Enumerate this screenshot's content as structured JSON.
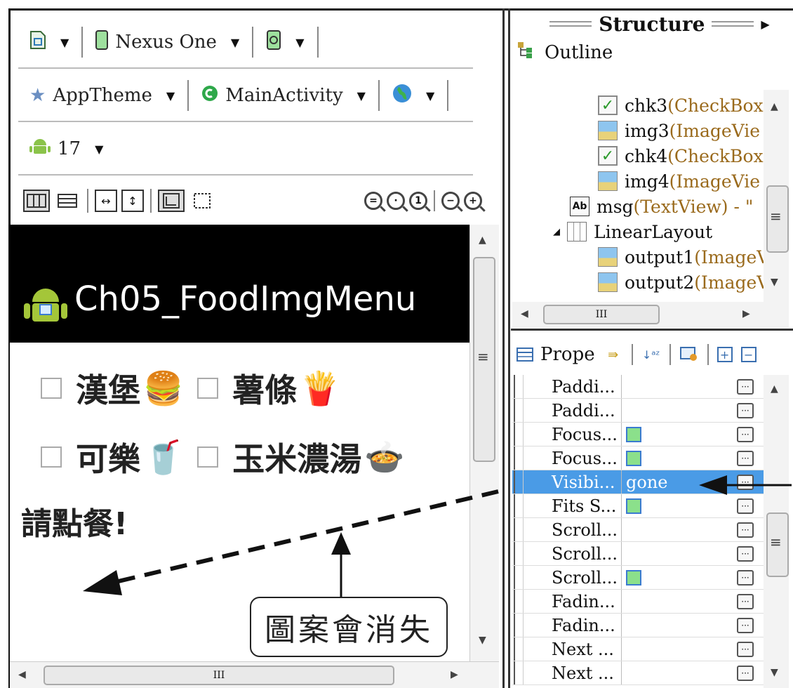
{
  "toolbar": {
    "device": "Nexus One",
    "theme": "AppTheme",
    "activity": "MainActivity",
    "api_level": "17"
  },
  "preview": {
    "app_title": "Ch05_FoodImgMenu",
    "checkboxes": [
      {
        "label": "漢堡",
        "emoji": "🍔"
      },
      {
        "label": "薯條",
        "emoji": "🍟"
      },
      {
        "label": "可樂",
        "emoji": "🥤"
      },
      {
        "label": "玉米濃湯",
        "emoji": "🍲"
      }
    ],
    "message": "請點餐!",
    "scroll_thumb_glyph": "III"
  },
  "callout": {
    "text": "圖案會消失"
  },
  "structure_panel": {
    "title": "Structure",
    "outline_label": "Outline",
    "tree": [
      {
        "name": "chk3",
        "type": " (CheckBox",
        "icon": "checkbox-icon"
      },
      {
        "name": "img3",
        "type": " (ImageVie",
        "icon": "imageview-icon"
      },
      {
        "name": "chk4",
        "type": " (CheckBox",
        "icon": "checkbox-icon"
      },
      {
        "name": "img4",
        "type": " (ImageVie",
        "icon": "imageview-icon"
      },
      {
        "name": "msg",
        "type": " (TextView) - \"",
        "icon": "textview-icon"
      },
      {
        "name": "LinearLayout",
        "type": "",
        "icon": "linearlayout-icon"
      },
      {
        "name": "output1",
        "type": " (ImageV",
        "icon": "imageview-icon"
      },
      {
        "name": "output2",
        "type": " (ImageV",
        "icon": "imageview-icon"
      }
    ],
    "scroll_thumb_glyph": "III"
  },
  "properties_panel": {
    "tab_label": "Prope",
    "rows": [
      {
        "name": "Paddi...",
        "value": "",
        "bool": false
      },
      {
        "name": "Paddi...",
        "value": "",
        "bool": false
      },
      {
        "name": "Focus...",
        "value": "",
        "bool": true
      },
      {
        "name": "Focus...",
        "value": "",
        "bool": true
      },
      {
        "name": "Visibi...",
        "value": "gone",
        "bool": false,
        "selected": true
      },
      {
        "name": "Fits S...",
        "value": "",
        "bool": true
      },
      {
        "name": "Scroll...",
        "value": "",
        "bool": false
      },
      {
        "name": "Scroll...",
        "value": "",
        "bool": false
      },
      {
        "name": "Scroll...",
        "value": "",
        "bool": true
      },
      {
        "name": "Fadin...",
        "value": "",
        "bool": false
      },
      {
        "name": "Fadin...",
        "value": "",
        "bool": false
      },
      {
        "name": "Next ...",
        "value": "",
        "bool": false
      },
      {
        "name": "Next ...",
        "value": "",
        "bool": false
      }
    ],
    "more_glyph": "···"
  },
  "colors": {
    "selection": "#4a9be6",
    "actionbar": "#000000",
    "type_text": "#9a6a1c"
  }
}
